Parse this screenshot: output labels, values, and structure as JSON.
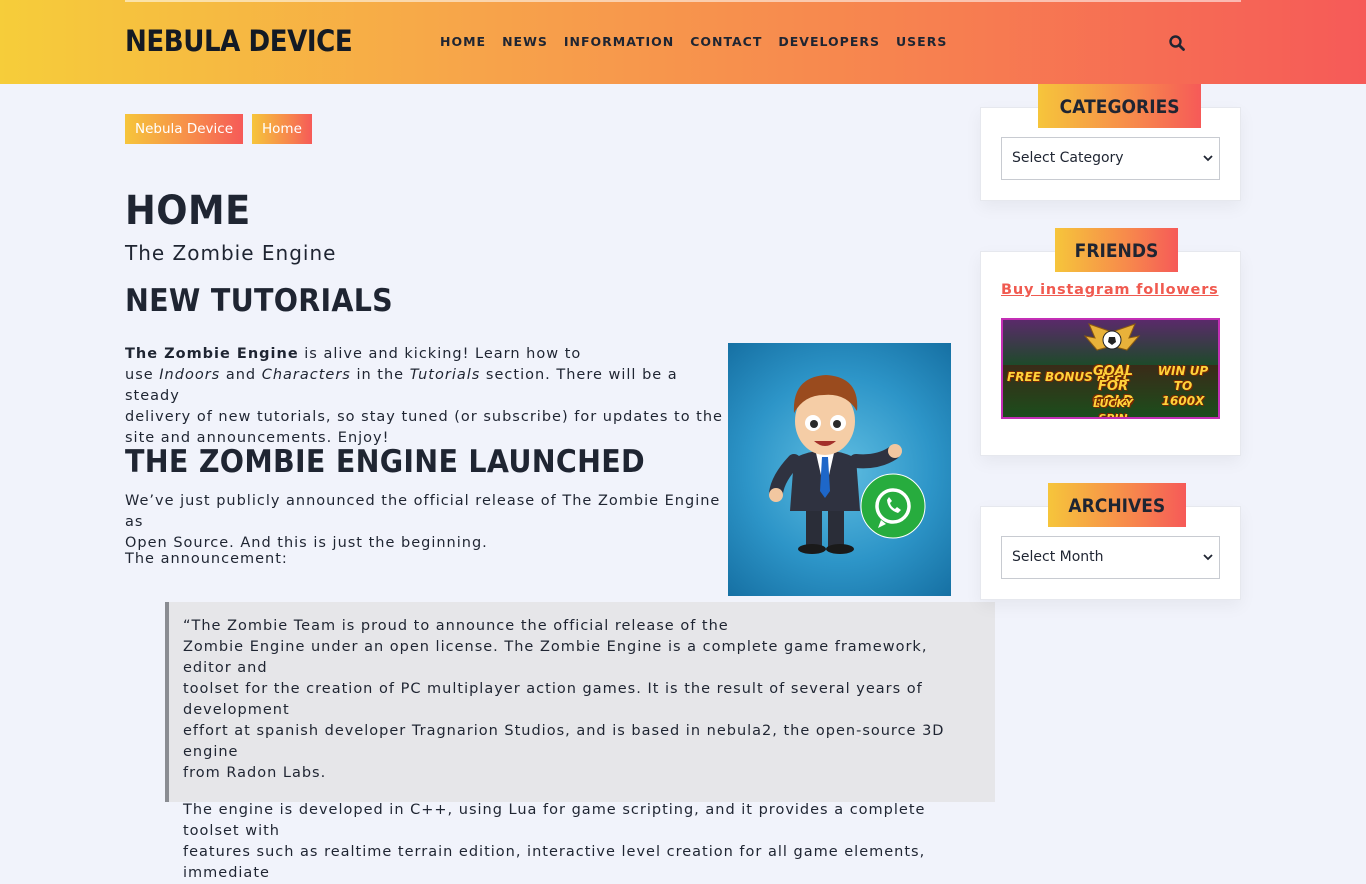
{
  "site": {
    "logo": "NEBULA DEVICE"
  },
  "nav": [
    "HOME",
    "NEWS",
    "INFORMATION",
    "CONTACT",
    "DEVELOPERS",
    "USERS"
  ],
  "breadcrumbs": [
    "Nebula Device",
    "Home"
  ],
  "main": {
    "title": "HOME",
    "subtitle": "The Zombie Engine",
    "section1_heading": "NEW TUTORIALS",
    "p1": {
      "bold": "The Zombie Engine",
      "t1": " is alive and kicking! Learn how to",
      "t2": "use ",
      "i1": "Indoors",
      "t3": " and ",
      "i2": "Characters",
      "t4": " in the ",
      "i3": "Tutorials",
      "t5": " section. There will be a steady",
      "line3": "delivery of new tutorials, so stay tuned (or subscribe) for updates to the",
      "line4": "site and announcements. Enjoy!"
    },
    "section2_heading": "THE ZOMBIE ENGINE LAUNCHED",
    "p2_line1": "We’ve just publicly announced the official release of The Zombie Engine as",
    "p2_line2": "Open Source. And this is just the beginning.",
    "p3": "The announcement:",
    "quote": {
      "q1_line1": "“The Zombie Team is proud to announce the official release of the",
      "q1_line2": "Zombie Engine under an open license. The Zombie Engine is a complete game framework, editor and",
      "q1_line3": "toolset for the creation of PC multiplayer action games. It is the result of several years of development",
      "q1_line4": "effort at spanish developer Tragnarion Studios, and is based in nebula2, the open-source 3D engine",
      "q1_line5": "from Radon Labs.",
      "q2_line1": "The engine is developed in C++, using Lua for game scripting, and it provides a complete toolset with",
      "q2_line2": "features such as realtime terrain edition, interactive level creation for all game elements, immediate"
    }
  },
  "sidebar": {
    "categories": {
      "title": "CATEGORIES",
      "select": "Select Category"
    },
    "friends": {
      "title": "FRIENDS",
      "link": "Buy instagram followers",
      "banner": {
        "left": "FREE BONUS REEL",
        "center": "GOAL FOR GOLD",
        "sub": "LUCKY SPIN",
        "right": "WIN UP TO 1600X"
      }
    },
    "archives": {
      "title": "ARCHIVES",
      "select": "Select Month"
    }
  },
  "colors": {
    "accent_start": "#f6cd3a",
    "accent_end": "#f65a58",
    "link": "#f05a50",
    "text": "#1f2532",
    "background": "#f1f3fb"
  }
}
